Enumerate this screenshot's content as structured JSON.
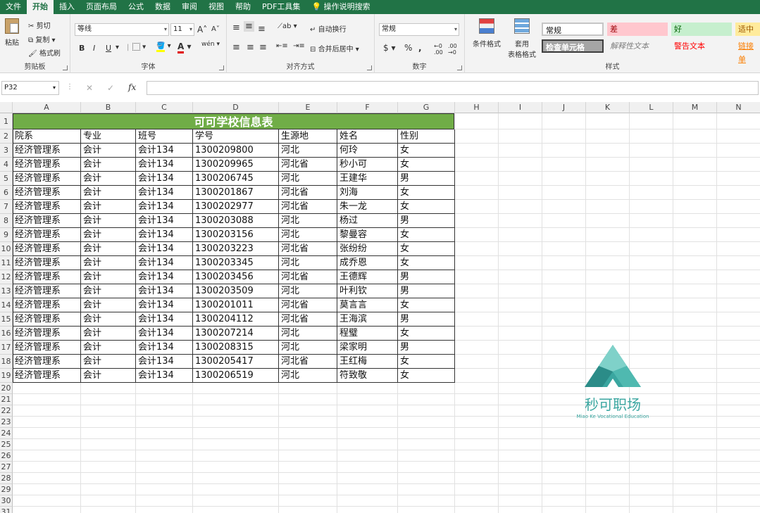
{
  "tabs": [
    "文件",
    "开始",
    "插入",
    "页面布局",
    "公式",
    "数据",
    "审阅",
    "视图",
    "帮助",
    "PDF工具集",
    "操作说明搜索"
  ],
  "ribbon": {
    "clipboard": {
      "paste": "粘贴",
      "cut": "剪切",
      "copy": "复制",
      "format_painter": "格式刷",
      "label": "剪贴板"
    },
    "font": {
      "name": "等线",
      "size": "11",
      "label": "字体",
      "bold": "B",
      "italic": "I",
      "underline": "U",
      "grow": "A",
      "shrink": "A"
    },
    "alignment": {
      "wrap": "自动换行",
      "merge": "合并后居中",
      "label": "对齐方式"
    },
    "number": {
      "format": "常规",
      "currency": "$",
      "percent": "%",
      "comma": ",",
      "label": "数字"
    },
    "styles": {
      "conditional": "条件格式",
      "table_format_line1": "套用",
      "table_format_line2": "表格格式",
      "normal": "常规",
      "bad": "差",
      "good": "好",
      "neutral": "适中",
      "check": "检查单元格",
      "explanatory": "解释性文本",
      "warning": "警告文本",
      "link": "链接单",
      "label": "样式"
    }
  },
  "formula_bar": {
    "name_box": "P32",
    "fx": "fx",
    "cancel": "✕",
    "enter": "✓",
    "value": ""
  },
  "columns": [
    "A",
    "B",
    "C",
    "D",
    "E",
    "F",
    "G",
    "H",
    "I",
    "J",
    "K",
    "L",
    "M",
    "N"
  ],
  "rows": [
    "1",
    "2",
    "3",
    "4",
    "5",
    "6",
    "7",
    "8",
    "9",
    "10",
    "11",
    "12",
    "13",
    "14",
    "15",
    "16",
    "17",
    "18",
    "19",
    "20",
    "21",
    "22",
    "23",
    "24",
    "25",
    "26",
    "27",
    "28",
    "29",
    "30",
    "31"
  ],
  "sheet": {
    "title": "可可学校信息表",
    "headers": [
      "院系",
      "专业",
      "班号",
      "学号",
      "生源地",
      "姓名",
      "性别"
    ],
    "data": [
      [
        "经济管理系",
        "会计",
        "会计134",
        "1300209800",
        "河北",
        "何玲",
        "女"
      ],
      [
        "经济管理系",
        "会计",
        "会计134",
        "1300209965",
        "河北省",
        "秒小可",
        "女"
      ],
      [
        "经济管理系",
        "会计",
        "会计134",
        "1300206745",
        "河北",
        "王建华",
        "男"
      ],
      [
        "经济管理系",
        "会计",
        "会计134",
        "1300201867",
        "河北省",
        "刘海",
        "女"
      ],
      [
        "经济管理系",
        "会计",
        "会计134",
        "1300202977",
        "河北省",
        "朱一龙",
        "女"
      ],
      [
        "经济管理系",
        "会计",
        "会计134",
        "1300203088",
        "河北",
        "杨过",
        "男"
      ],
      [
        "经济管理系",
        "会计",
        "会计134",
        "1300203156",
        "河北",
        "黎曼容",
        "女"
      ],
      [
        "经济管理系",
        "会计",
        "会计134",
        "1300203223",
        "河北省",
        "张纷纷",
        "女"
      ],
      [
        "经济管理系",
        "会计",
        "会计134",
        "1300203345",
        "河北",
        "成乔恩",
        "女"
      ],
      [
        "经济管理系",
        "会计",
        "会计134",
        "1300203456",
        "河北省",
        "王德辉",
        "男"
      ],
      [
        "经济管理系",
        "会计",
        "会计134",
        "1300203509",
        "河北",
        "叶利钦",
        "男"
      ],
      [
        "经济管理系",
        "会计",
        "会计134",
        "1300201011",
        "河北省",
        "莫言言",
        "女"
      ],
      [
        "经济管理系",
        "会计",
        "会计134",
        "1300204112",
        "河北省",
        "王海滨",
        "男"
      ],
      [
        "经济管理系",
        "会计",
        "会计134",
        "1300207214",
        "河北",
        "程璧",
        "女"
      ],
      [
        "经济管理系",
        "会计",
        "会计134",
        "1300208315",
        "河北",
        "梁家明",
        "男"
      ],
      [
        "经济管理系",
        "会计",
        "会计134",
        "1300205417",
        "河北省",
        "王红梅",
        "女"
      ],
      [
        "经济管理系",
        "会计",
        "会计134",
        "1300206519",
        "河北",
        "符致敬",
        "女"
      ]
    ]
  },
  "watermark": {
    "name": "秒可职场",
    "sub": "Miao Ke Vocational Education"
  },
  "colors": {
    "brand": "#217346",
    "title_fill": "#70ad47",
    "logo": "#3aa6a0"
  }
}
